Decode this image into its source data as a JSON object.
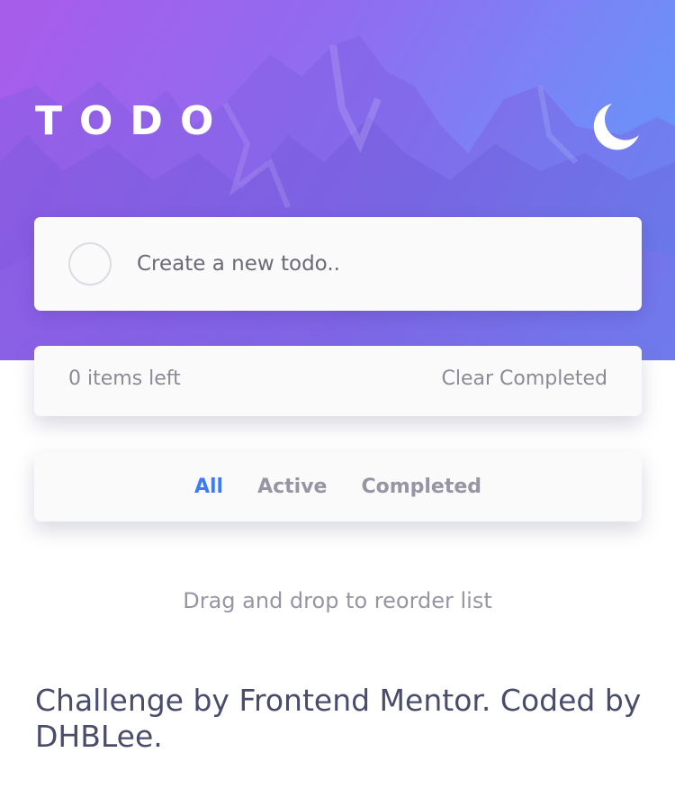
{
  "header": {
    "title": "TODO",
    "theme_icon": "moon-icon"
  },
  "new_todo": {
    "placeholder": "Create a new todo.."
  },
  "footer": {
    "items_left": "0 items left",
    "clear_label": "Clear Completed"
  },
  "filters": [
    {
      "label": "All",
      "active": true
    },
    {
      "label": "Active",
      "active": false
    },
    {
      "label": "Completed",
      "active": false
    }
  ],
  "hint": "Drag and drop to reorder list",
  "attribution": "Challenge by Frontend Mentor. Coded by DHBLee.",
  "colors": {
    "accent": "#3a7bfd",
    "gradient_start": "#a65ee9",
    "gradient_end": "#5d9bf8",
    "text_muted": "#9795a3",
    "text_dark": "#494c6b",
    "card_bg": "#fafafa"
  }
}
